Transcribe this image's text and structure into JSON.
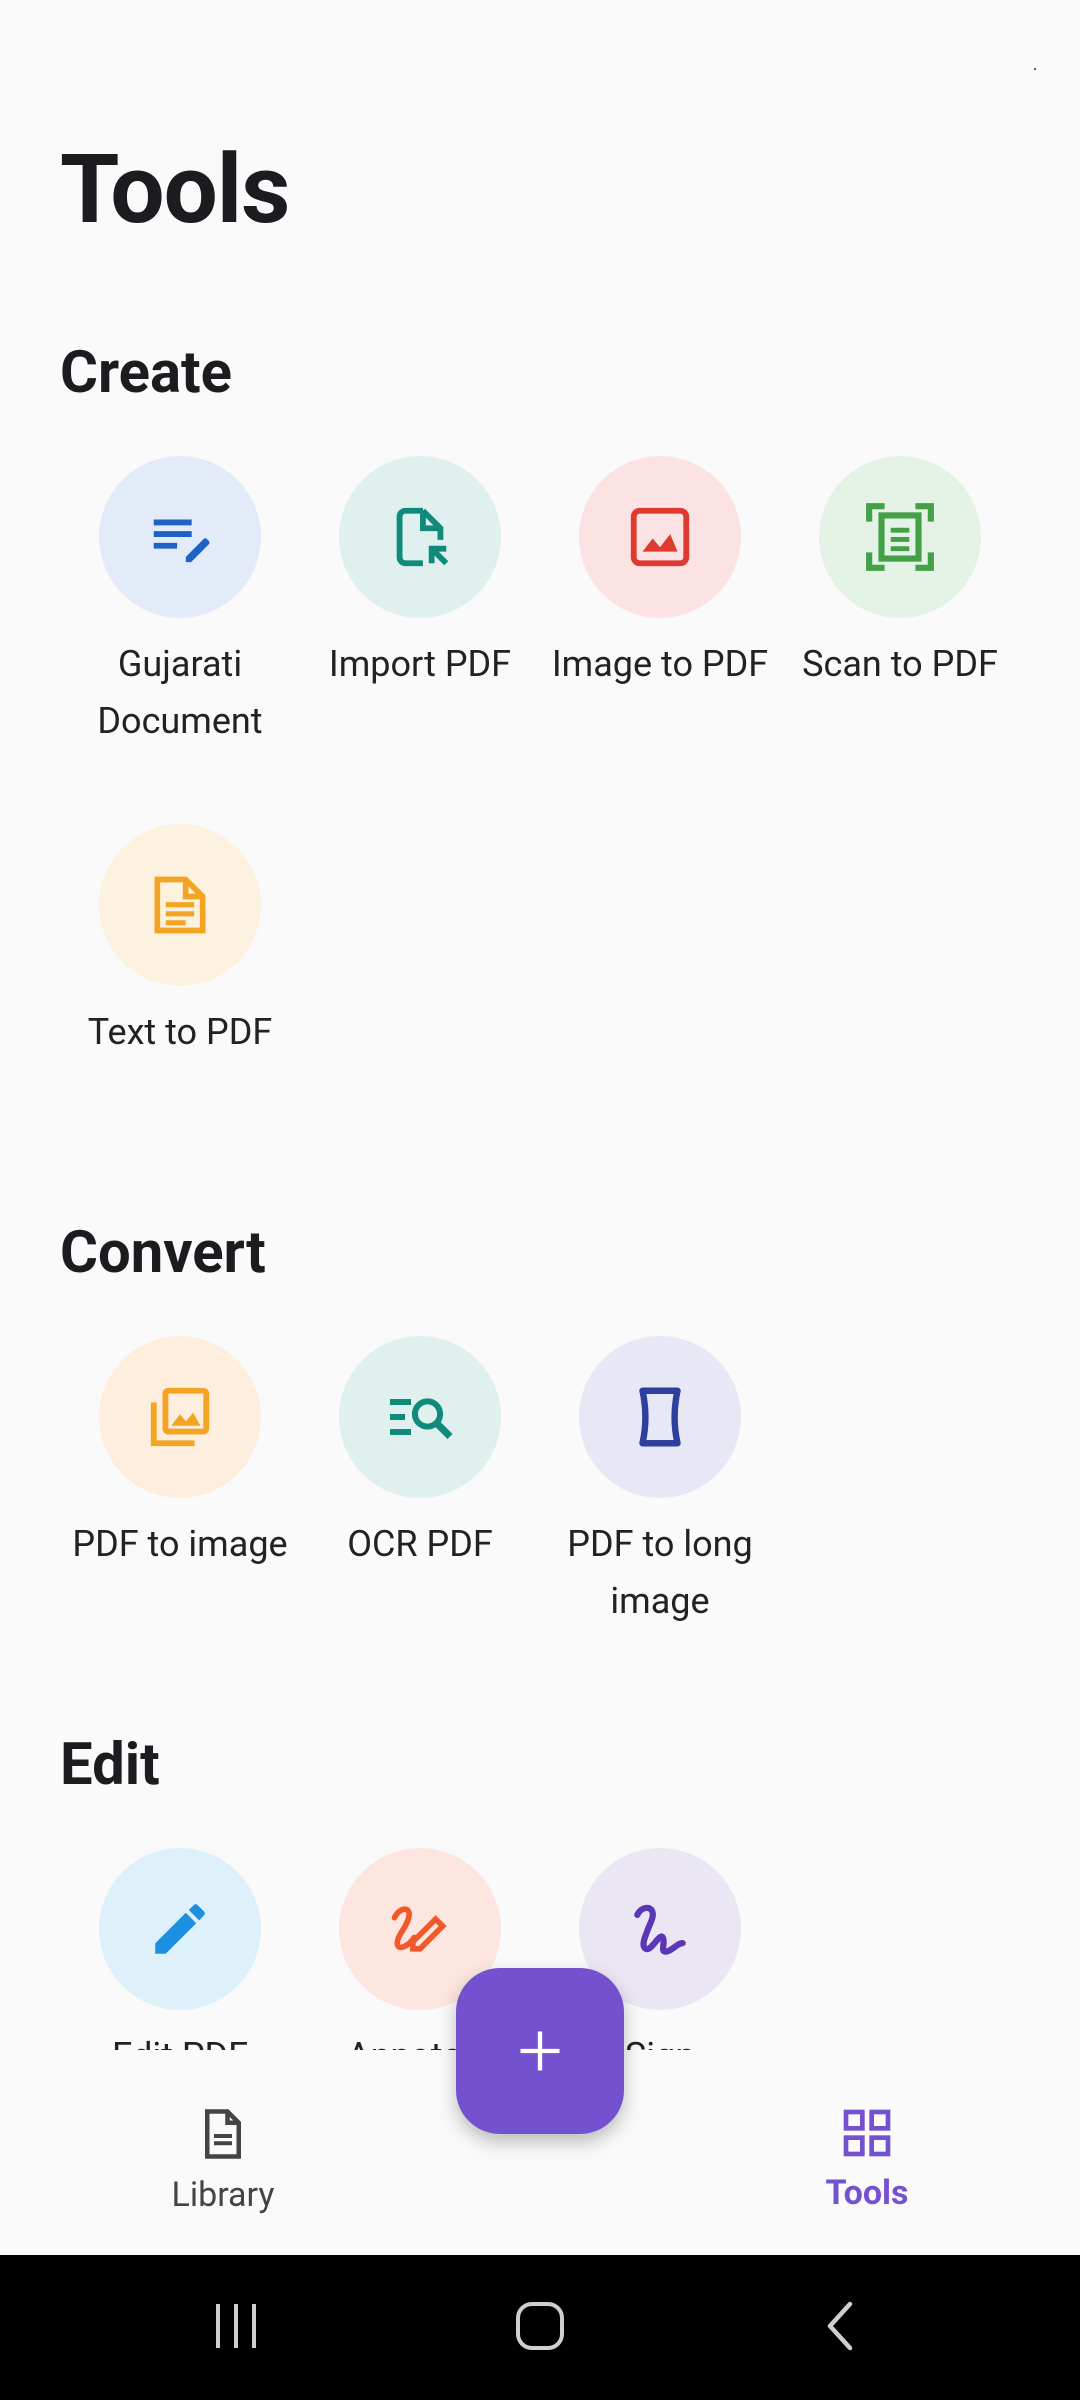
{
  "page": {
    "title": "Tools"
  },
  "sections": {
    "create": {
      "title": "Create",
      "items": [
        {
          "label": "Gujarati Document",
          "icon": "edit-document-icon"
        },
        {
          "label": "Import PDF",
          "icon": "import-file-icon"
        },
        {
          "label": "Image to PDF",
          "icon": "image-icon"
        },
        {
          "label": "Scan to PDF",
          "icon": "scan-document-icon"
        },
        {
          "label": "Text to PDF",
          "icon": "text-document-icon"
        }
      ]
    },
    "convert": {
      "title": "Convert",
      "items": [
        {
          "label": "PDF to image",
          "icon": "image-stack-icon"
        },
        {
          "label": "OCR PDF",
          "icon": "ocr-search-icon"
        },
        {
          "label": "PDF to long image",
          "icon": "long-image-icon"
        }
      ]
    },
    "edit": {
      "title": "Edit",
      "items": [
        {
          "label": "Edit PDF",
          "icon": "pencil-icon"
        },
        {
          "label": "Annotate",
          "icon": "annotate-icon"
        },
        {
          "label": "Sign",
          "icon": "signature-icon"
        }
      ]
    }
  },
  "bottom_nav": {
    "library": "Library",
    "tools": "Tools",
    "active": "tools"
  },
  "colors": {
    "accent": "#7451ce",
    "blue": "#1e63c4",
    "teal": "#0f8a7b",
    "red": "#e0392f",
    "green": "#43a047",
    "orange": "#f4a423",
    "indigo": "#2f3f9e",
    "sky": "#1d8fe0",
    "coral": "#f05a2a",
    "purple": "#5a37b4"
  }
}
